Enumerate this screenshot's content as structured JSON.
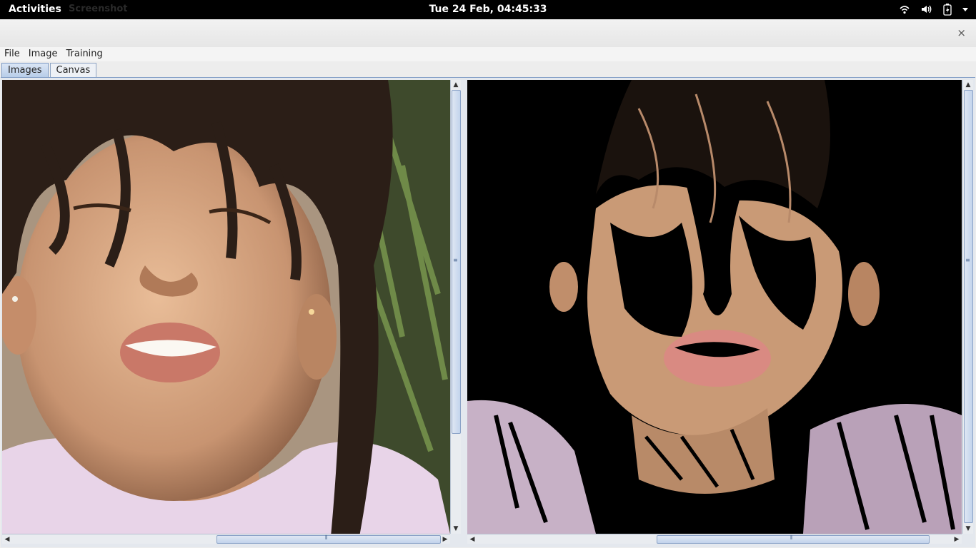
{
  "topbar": {
    "activities": "Activities",
    "app_ghost": "Screenshot",
    "clock": "Tue 24 Feb, 04:45:33"
  },
  "window": {
    "close": "×"
  },
  "menubar": {
    "items": [
      "File",
      "Image",
      "Training"
    ]
  },
  "tabs": [
    {
      "label": "Images",
      "active": true
    },
    {
      "label": "Canvas",
      "active": false
    }
  ],
  "panes": {
    "left": {
      "scroll_v": 0.0,
      "scroll_h": 0.55
    },
    "right": {
      "scroll_v": 0.0,
      "scroll_h": 0.38
    }
  },
  "colors": {
    "accent": "#7d9ac4",
    "skin": "#c99a76",
    "hair": "#2b1e17",
    "shirt": "#e6d2e6"
  }
}
